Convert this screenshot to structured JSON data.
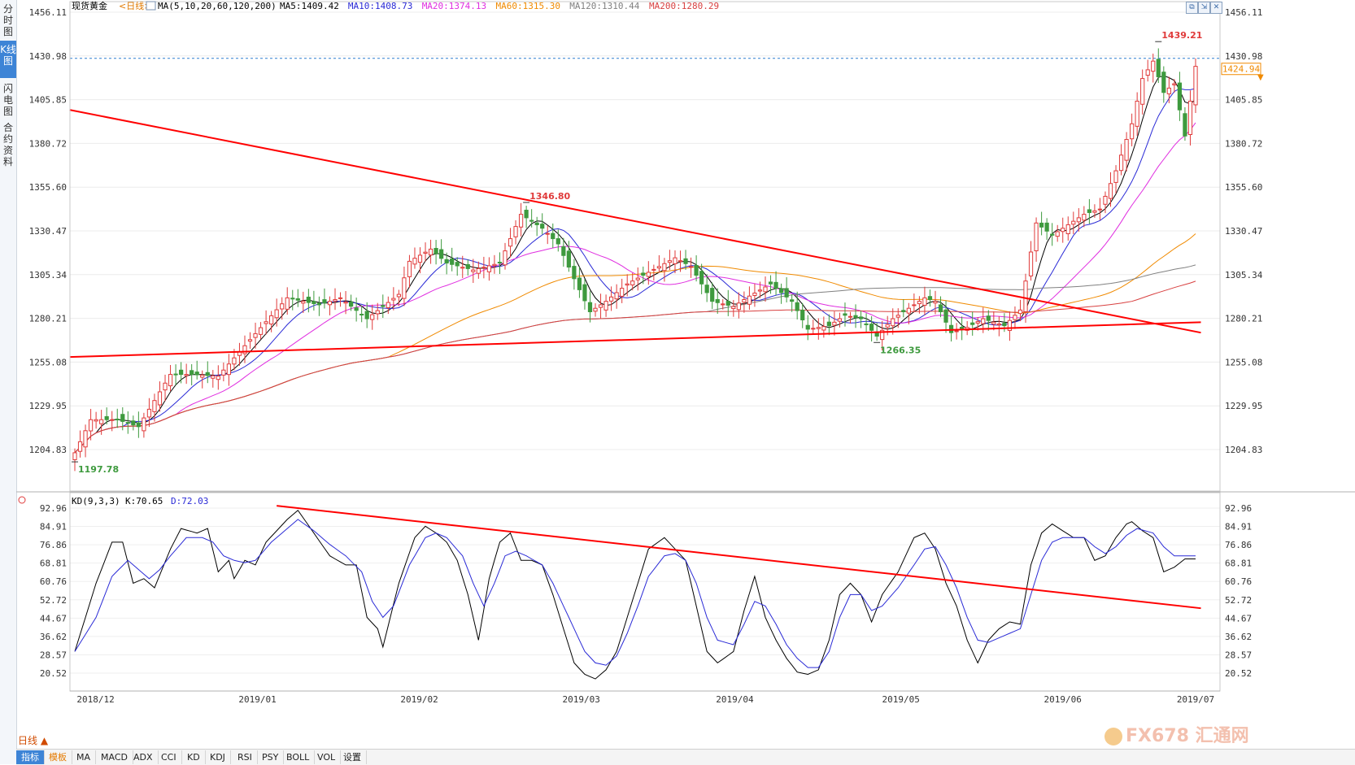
{
  "instrument": "现货黄金",
  "period": "<日线>",
  "ma_header": "MA(5,10,20,60,120,200)",
  "ma_values": [
    {
      "label": "MA5:1409.42",
      "color": "#000000"
    },
    {
      "label": "MA10:1408.73",
      "color": "#2a2ad6"
    },
    {
      "label": "MA20:1374.13",
      "color": "#e02ee0"
    },
    {
      "label": "MA60:1315.30",
      "color": "#f08a00"
    },
    {
      "label": "MA120:1310.44",
      "color": "#808080"
    },
    {
      "label": "MA200:1280.29",
      "color": "#d84040"
    }
  ],
  "sidebar_tabs": [
    "分时图",
    "K线图",
    "闪电图",
    "合约资料"
  ],
  "price_axis_ticks": [
    "1456.11",
    "1430.98",
    "1405.85",
    "1380.72",
    "1355.60",
    "1330.47",
    "1305.34",
    "1280.21",
    "1255.08",
    "1229.95",
    "1204.83"
  ],
  "price_axis_values": [
    1456.11,
    1430.98,
    1405.85,
    1380.72,
    1355.6,
    1330.47,
    1305.34,
    1280.21,
    1255.08,
    1229.95,
    1204.83
  ],
  "current_price_tag": "1424.94",
  "annotations": {
    "high": "1439.21",
    "mid_high": "1346.80",
    "low_start": "1197.78",
    "low_may": "1266.35"
  },
  "kd_header": "KD(9,3,3)",
  "kd_k": "K:70.65",
  "kd_d": "D:72.03",
  "kd_axis_ticks": [
    "92.96",
    "84.91",
    "76.86",
    "68.81",
    "60.76",
    "52.72",
    "44.67",
    "36.62",
    "28.57",
    "20.52"
  ],
  "kd_axis_values": [
    92.96,
    84.91,
    76.86,
    68.81,
    60.76,
    52.72,
    44.67,
    36.62,
    28.57,
    20.52
  ],
  "date_labels": [
    "2018/12",
    "2019/01",
    "2019/02",
    "2019/03",
    "2019/04",
    "2019/05",
    "2019/06",
    "2019/07"
  ],
  "period_button": "日线 ▲",
  "bottom_tabs": [
    "指标",
    "模板",
    "MA",
    "MACD",
    "ADX",
    "CCI",
    "KD",
    "KDJ",
    "RSI",
    "PSY",
    "BOLL",
    "VOL",
    "设置"
  ],
  "watermark": "FX678 汇通网",
  "colors": {
    "up": "#e03a3a",
    "down": "#3e9a3e",
    "trend": "#ff0000",
    "price_line": "#2f7fd0",
    "tag": "#f08a00"
  },
  "chart_data": [
    {
      "type": "candlestick",
      "title": "现货黄金 <日线>",
      "ylim": [
        1190,
        1460
      ],
      "x_labels": [
        "2018/12",
        "2019/01",
        "2019/02",
        "2019/03",
        "2019/04",
        "2019/05",
        "2019/06",
        "2019/07"
      ],
      "close_keypoints": [
        [
          0,
          1203
        ],
        [
          3,
          1222
        ],
        [
          8,
          1222
        ],
        [
          12,
          1218
        ],
        [
          18,
          1248
        ],
        [
          22,
          1248
        ],
        [
          27,
          1247
        ],
        [
          33,
          1268
        ],
        [
          40,
          1292
        ],
        [
          46,
          1288
        ],
        [
          50,
          1292
        ],
        [
          55,
          1280
        ],
        [
          61,
          1294
        ],
        [
          63,
          1313
        ],
        [
          67,
          1320
        ],
        [
          70,
          1312
        ],
        [
          75,
          1308
        ],
        [
          80,
          1312
        ],
        [
          84,
          1340
        ],
        [
          88,
          1332
        ],
        [
          91,
          1323
        ],
        [
          94,
          1303
        ],
        [
          97,
          1284
        ],
        [
          100,
          1290
        ],
        [
          104,
          1300
        ],
        [
          107,
          1305
        ],
        [
          113,
          1315
        ],
        [
          116,
          1310
        ],
        [
          120,
          1290
        ],
        [
          124,
          1287
        ],
        [
          127,
          1293
        ],
        [
          131,
          1300
        ],
        [
          135,
          1290
        ],
        [
          138,
          1274
        ],
        [
          142,
          1276
        ],
        [
          145,
          1282
        ],
        [
          148,
          1280
        ],
        [
          151,
          1270
        ],
        [
          154,
          1280
        ],
        [
          157,
          1286
        ],
        [
          160,
          1292
        ],
        [
          162,
          1290
        ],
        [
          165,
          1272
        ],
        [
          168,
          1275
        ],
        [
          171,
          1280
        ],
        [
          175,
          1276
        ],
        [
          178,
          1285
        ],
        [
          181,
          1335
        ],
        [
          184,
          1328
        ],
        [
          187,
          1334
        ],
        [
          190,
          1340
        ],
        [
          193,
          1343
        ],
        [
          196,
          1365
        ],
        [
          199,
          1392
        ],
        [
          201,
          1418
        ],
        [
          203,
          1428
        ],
        [
          205,
          1410
        ],
        [
          207,
          1415
        ],
        [
          209,
          1385
        ],
        [
          211,
          1425
        ]
      ],
      "annotations": [
        {
          "label": "1439.21",
          "index": 204,
          "kind": "high"
        },
        {
          "label": "1346.80",
          "index": 85,
          "kind": "high"
        },
        {
          "label": "1197.78",
          "index": 0,
          "kind": "low"
        },
        {
          "label": "1266.35",
          "index": 151,
          "kind": "low"
        }
      ],
      "trendlines": [
        {
          "name": "resistance",
          "from": [
            -1,
            1400
          ],
          "to": [
            212,
            1272
          ]
        },
        {
          "name": "support",
          "from": [
            -1,
            1258
          ],
          "to": [
            212,
            1278
          ]
        }
      ],
      "last_price": 1424.94,
      "moving_averages": {
        "MA5": 1409.42,
        "MA10": 1408.73,
        "MA20": 1374.13,
        "MA60": 1315.3,
        "MA120": 1310.44,
        "MA200": 1280.29
      }
    },
    {
      "type": "line",
      "title": "KD(9,3,3)",
      "ylim": [
        16,
        96
      ],
      "series": [
        {
          "name": "K",
          "color": "#000000",
          "keypoints": [
            [
              0,
              30
            ],
            [
              4,
              60
            ],
            [
              7,
              78
            ],
            [
              9,
              78
            ],
            [
              11,
              60
            ],
            [
              13,
              62
            ],
            [
              15,
              58
            ],
            [
              18,
              75
            ],
            [
              20,
              84
            ],
            [
              23,
              82
            ],
            [
              25,
              84
            ],
            [
              27,
              65
            ],
            [
              29,
              70
            ],
            [
              30,
              62
            ],
            [
              32,
              70
            ],
            [
              34,
              68
            ],
            [
              36,
              78
            ],
            [
              40,
              88
            ],
            [
              42,
              92
            ],
            [
              45,
              82
            ],
            [
              48,
              72
            ],
            [
              51,
              68
            ],
            [
              53,
              68
            ],
            [
              55,
              45
            ],
            [
              57,
              40
            ],
            [
              58,
              32
            ],
            [
              61,
              60
            ],
            [
              64,
              80
            ],
            [
              66,
              85
            ],
            [
              68,
              82
            ],
            [
              70,
              78
            ],
            [
              72,
              70
            ],
            [
              74,
              55
            ],
            [
              76,
              35
            ],
            [
              78,
              62
            ],
            [
              80,
              78
            ],
            [
              82,
              82
            ],
            [
              84,
              70
            ],
            [
              86,
              70
            ],
            [
              88,
              68
            ],
            [
              90,
              55
            ],
            [
              92,
              40
            ],
            [
              94,
              25
            ],
            [
              96,
              20
            ],
            [
              98,
              18
            ],
            [
              100,
              22
            ],
            [
              102,
              30
            ],
            [
              104,
              45
            ],
            [
              106,
              60
            ],
            [
              108,
              75
            ],
            [
              111,
              80
            ],
            [
              113,
              75
            ],
            [
              115,
              70
            ],
            [
              117,
              50
            ],
            [
              119,
              30
            ],
            [
              121,
              25
            ],
            [
              124,
              30
            ],
            [
              126,
              48
            ],
            [
              128,
              63
            ],
            [
              130,
              45
            ],
            [
              132,
              35
            ],
            [
              134,
              27
            ],
            [
              136,
              21
            ],
            [
              138,
              20
            ],
            [
              140,
              22
            ],
            [
              142,
              35
            ],
            [
              144,
              55
            ],
            [
              146,
              60
            ],
            [
              148,
              55
            ],
            [
              150,
              43
            ],
            [
              152,
              55
            ],
            [
              155,
              65
            ],
            [
              158,
              80
            ],
            [
              160,
              82
            ],
            [
              162,
              75
            ],
            [
              164,
              60
            ],
            [
              166,
              50
            ],
            [
              168,
              35
            ],
            [
              170,
              25
            ],
            [
              172,
              35
            ],
            [
              174,
              40
            ],
            [
              176,
              43
            ],
            [
              178,
              42
            ],
            [
              180,
              68
            ],
            [
              182,
              82
            ],
            [
              184,
              86
            ],
            [
              186,
              83
            ],
            [
              188,
              80
            ],
            [
              190,
              80
            ],
            [
              192,
              70
            ],
            [
              194,
              72
            ],
            [
              196,
              80
            ],
            [
              198,
              86
            ],
            [
              199,
              87
            ],
            [
              201,
              83
            ],
            [
              203,
              80
            ],
            [
              205,
              65
            ],
            [
              207,
              67
            ],
            [
              209,
              70.65
            ]
          ]
        },
        {
          "name": "D",
          "color": "#2a2ad6",
          "keypoints": [
            [
              0,
              30
            ],
            [
              4,
              45
            ],
            [
              7,
              63
            ],
            [
              10,
              70
            ],
            [
              12,
              66
            ],
            [
              14,
              62
            ],
            [
              16,
              66
            ],
            [
              18,
              72
            ],
            [
              21,
              80
            ],
            [
              24,
              80
            ],
            [
              26,
              78
            ],
            [
              28,
              72
            ],
            [
              30,
              70
            ],
            [
              32,
              69
            ],
            [
              34,
              70
            ],
            [
              37,
              78
            ],
            [
              40,
              84
            ],
            [
              42,
              88
            ],
            [
              45,
              83
            ],
            [
              48,
              77
            ],
            [
              51,
              72
            ],
            [
              54,
              65
            ],
            [
              56,
              52
            ],
            [
              58,
              45
            ],
            [
              60,
              50
            ],
            [
              63,
              68
            ],
            [
              66,
              80
            ],
            [
              68,
              82
            ],
            [
              70,
              80
            ],
            [
              73,
              72
            ],
            [
              75,
              60
            ],
            [
              77,
              50
            ],
            [
              79,
              60
            ],
            [
              81,
              72
            ],
            [
              83,
              74
            ],
            [
              85,
              72
            ],
            [
              88,
              68
            ],
            [
              90,
              60
            ],
            [
              92,
              50
            ],
            [
              94,
              40
            ],
            [
              96,
              30
            ],
            [
              98,
              25
            ],
            [
              100,
              24
            ],
            [
              102,
              28
            ],
            [
              104,
              38
            ],
            [
              106,
              50
            ],
            [
              108,
              63
            ],
            [
              111,
              72
            ],
            [
              113,
              73
            ],
            [
              115,
              70
            ],
            [
              117,
              60
            ],
            [
              119,
              45
            ],
            [
              121,
              35
            ],
            [
              124,
              33
            ],
            [
              126,
              42
            ],
            [
              128,
              52
            ],
            [
              130,
              50
            ],
            [
              132,
              42
            ],
            [
              134,
              33
            ],
            [
              136,
              27
            ],
            [
              138,
              23
            ],
            [
              140,
              23
            ],
            [
              142,
              30
            ],
            [
              144,
              45
            ],
            [
              146,
              55
            ],
            [
              148,
              55
            ],
            [
              150,
              48
            ],
            [
              152,
              50
            ],
            [
              155,
              58
            ],
            [
              158,
              68
            ],
            [
              160,
              75
            ],
            [
              162,
              76
            ],
            [
              164,
              68
            ],
            [
              166,
              58
            ],
            [
              168,
              45
            ],
            [
              170,
              35
            ],
            [
              172,
              34
            ],
            [
              174,
              36
            ],
            [
              176,
              38
            ],
            [
              178,
              40
            ],
            [
              180,
              55
            ],
            [
              182,
              70
            ],
            [
              184,
              78
            ],
            [
              186,
              80
            ],
            [
              188,
              80
            ],
            [
              190,
              80
            ],
            [
              192,
              76
            ],
            [
              194,
              73
            ],
            [
              196,
              76
            ],
            [
              198,
              81
            ],
            [
              200,
              84
            ],
            [
              203,
              82
            ],
            [
              205,
              76
            ],
            [
              207,
              72
            ],
            [
              209,
              72.03
            ]
          ]
        }
      ],
      "trendlines": [
        {
          "name": "resistance",
          "from": [
            38,
            94
          ],
          "to": [
            212,
            49
          ]
        }
      ]
    }
  ]
}
